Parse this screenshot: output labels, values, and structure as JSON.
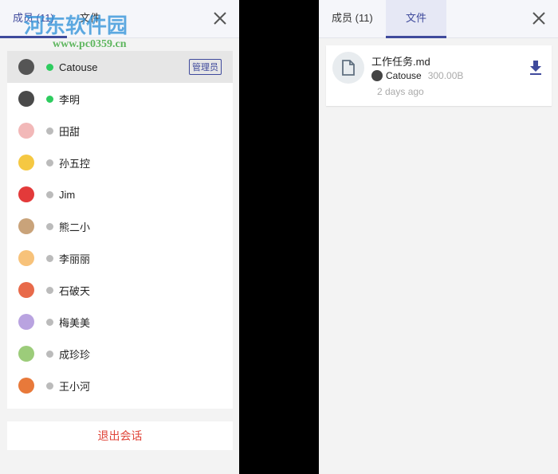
{
  "left": {
    "tabs": [
      {
        "label": "成员 (11)",
        "active": true
      },
      {
        "label": "文件",
        "active": false
      }
    ],
    "members": [
      {
        "name": "Catouse",
        "online": true,
        "badge": "管理员",
        "avatar_color": "#555"
      },
      {
        "name": "李明",
        "online": true,
        "avatar_color": "#4a4a4a"
      },
      {
        "name": "田甜",
        "online": false,
        "avatar_color": "#f2b8b8"
      },
      {
        "name": "孙五控",
        "online": false,
        "avatar_color": "#f5c842"
      },
      {
        "name": "Jim",
        "online": false,
        "avatar_color": "#e33a3a"
      },
      {
        "name": "熊二小",
        "online": false,
        "avatar_color": "#c9a37a"
      },
      {
        "name": "李丽丽",
        "online": false,
        "avatar_color": "#f7c27a"
      },
      {
        "name": "石破天",
        "online": false,
        "avatar_color": "#e86a4a"
      },
      {
        "name": "梅美美",
        "online": false,
        "avatar_color": "#b9a3e0"
      },
      {
        "name": "成珍珍",
        "online": false,
        "avatar_color": "#9ccc7a"
      },
      {
        "name": "王小河",
        "online": false,
        "avatar_color": "#e8793a"
      }
    ],
    "logout_label": "退出会话"
  },
  "right": {
    "tabs": [
      {
        "label": "成员 (11)",
        "active": false
      },
      {
        "label": "文件",
        "active": true
      }
    ],
    "file": {
      "name": "工作任务.md",
      "uploader": "Catouse",
      "size": "300.00B",
      "time": "2 days ago"
    }
  },
  "watermark": {
    "title": "河东软件园",
    "url": "www.pc0359.cn"
  },
  "colors": {
    "accent": "#3f4a9c",
    "online": "#2ecc5f",
    "offline": "#bbbbbb",
    "danger": "#e0463a"
  }
}
